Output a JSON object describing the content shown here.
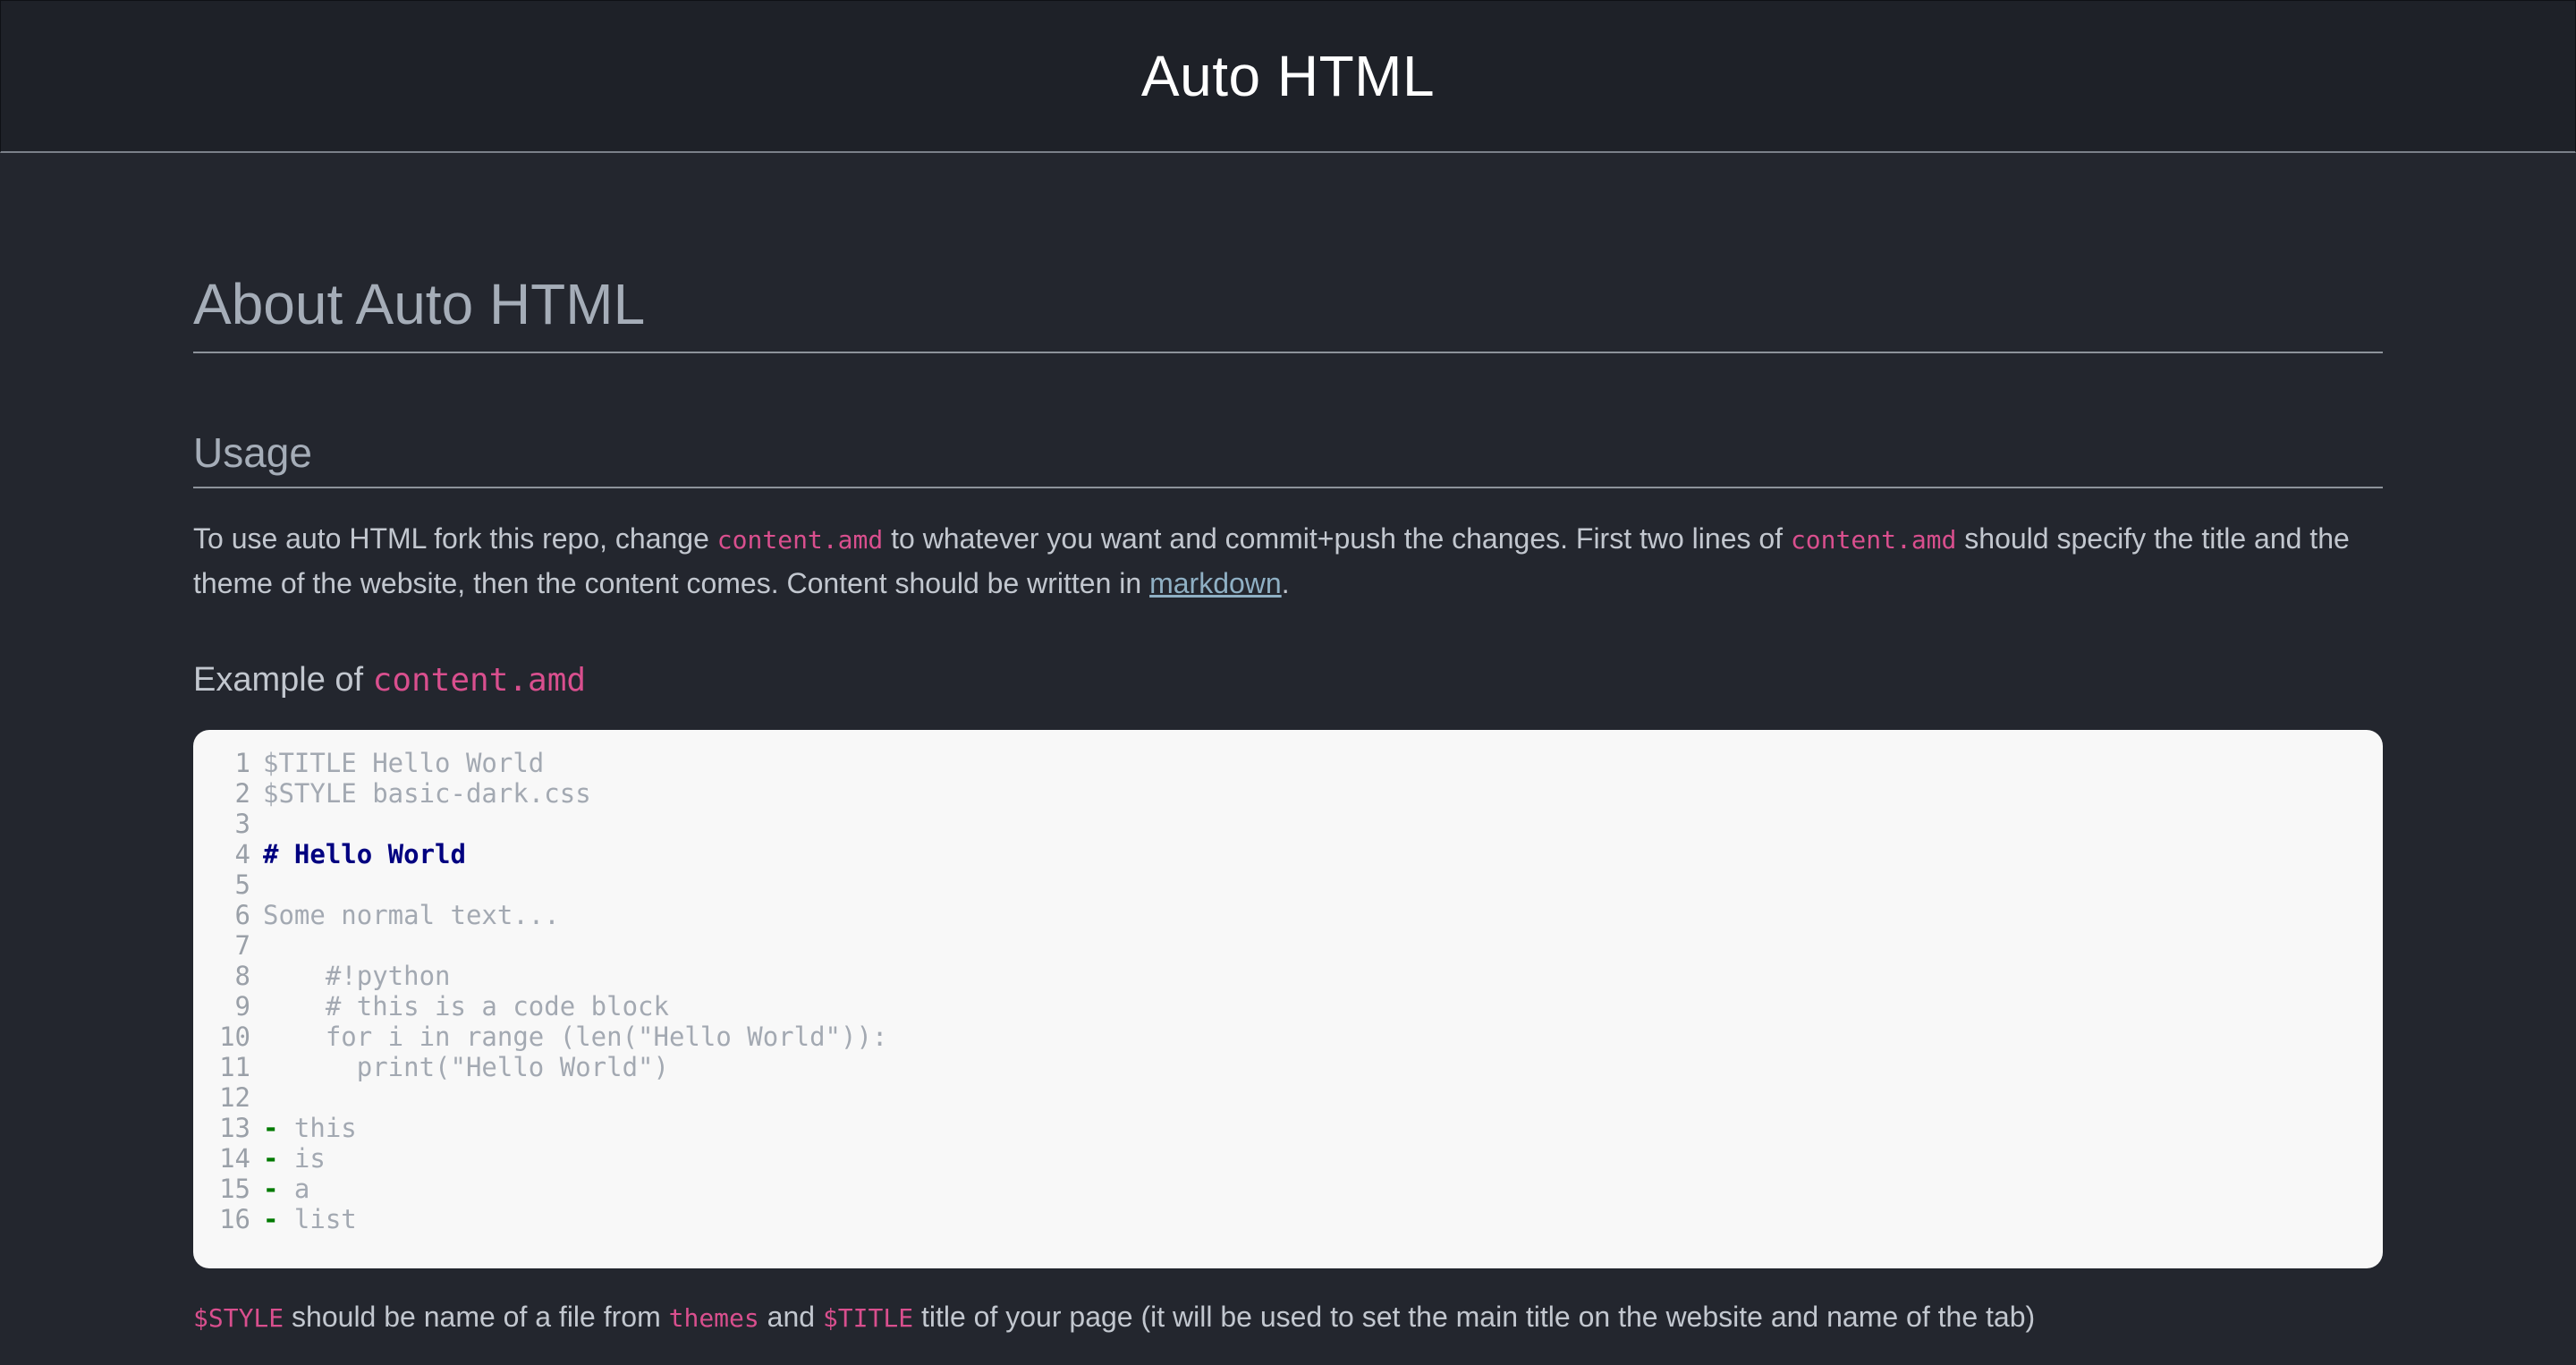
{
  "header": {
    "title": "Auto HTML"
  },
  "main": {
    "heading": "About Auto HTML",
    "usage_heading": "Usage",
    "paragraph": {
      "t1": "To use auto HTML fork this repo, change ",
      "c1": "content.amd",
      "t2": " to whatever you want and commit+push the changes. First two lines of ",
      "c2": "content.amd",
      "t3": " should specify the title and the theme of the website, then the content comes. Content should be written in ",
      "link": "markdown",
      "t4": "."
    },
    "example_heading": {
      "text": "Example of ",
      "code": "content.amd"
    },
    "code_lines": [
      {
        "n": "1",
        "text": "$TITLE Hello World"
      },
      {
        "n": "2",
        "text": "$STYLE basic-dark.css"
      },
      {
        "n": "3",
        "text": ""
      },
      {
        "n": "4",
        "text": "# Hello World"
      },
      {
        "n": "5",
        "text": ""
      },
      {
        "n": "6",
        "text": "Some normal text..."
      },
      {
        "n": "7",
        "text": ""
      },
      {
        "n": "8",
        "text": "    #!python"
      },
      {
        "n": "9",
        "text": "    # this is a code block"
      },
      {
        "n": "10",
        "text": "    for i in range (len(\"Hello World\")):"
      },
      {
        "n": "11",
        "text": "      print(\"Hello World\")"
      },
      {
        "n": "12",
        "text": ""
      },
      {
        "n": "13",
        "bullet": "-",
        "text": " this"
      },
      {
        "n": "14",
        "bullet": "-",
        "text": " is"
      },
      {
        "n": "15",
        "bullet": "-",
        "text": " a"
      },
      {
        "n": "16",
        "bullet": "-",
        "text": " list"
      }
    ],
    "note": {
      "c1": "$STYLE",
      "t1": " should be name of a file from ",
      "c2": "themes",
      "t2": " and ",
      "c3": "$TITLE",
      "t3": " title of your page (it will be used to set the main title on the website and name of the tab)"
    }
  },
  "colors": {
    "background": "#23262e",
    "header_bg": "#1e2128",
    "inline_code": "#d94f8e",
    "link": "#8fb0c4",
    "code_bg": "#f8f8f8",
    "md_heading": "#000080",
    "md_bullet": "#007a00"
  }
}
